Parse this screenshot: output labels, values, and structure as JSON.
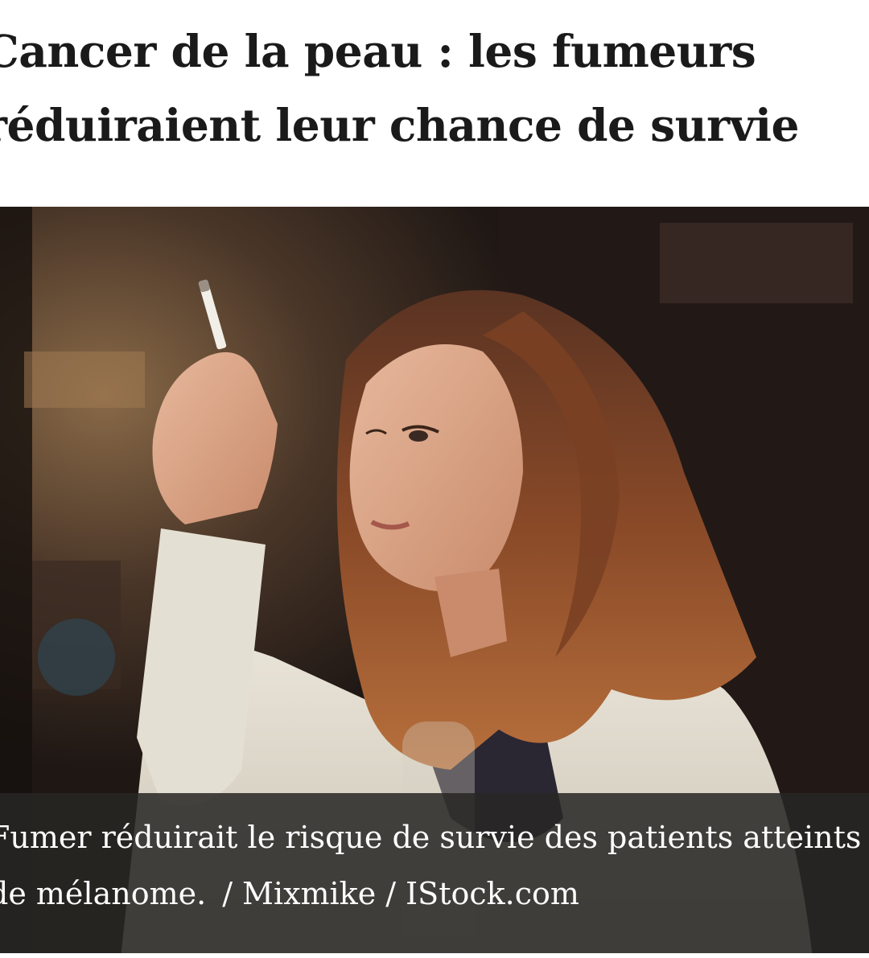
{
  "article": {
    "headline_line1": "Cancer de la peau : les fumeurs",
    "headline_line2": "réduiraient leur chance de survie"
  },
  "photo": {
    "subject": "photo-woman-smoking-cigarette"
  },
  "caption": {
    "line1": "Fumer réduirait le risque de survie des patients atteints",
    "line2": "de mélanome.",
    "separator": "/",
    "credit": "Mixmike / IStock.com"
  }
}
